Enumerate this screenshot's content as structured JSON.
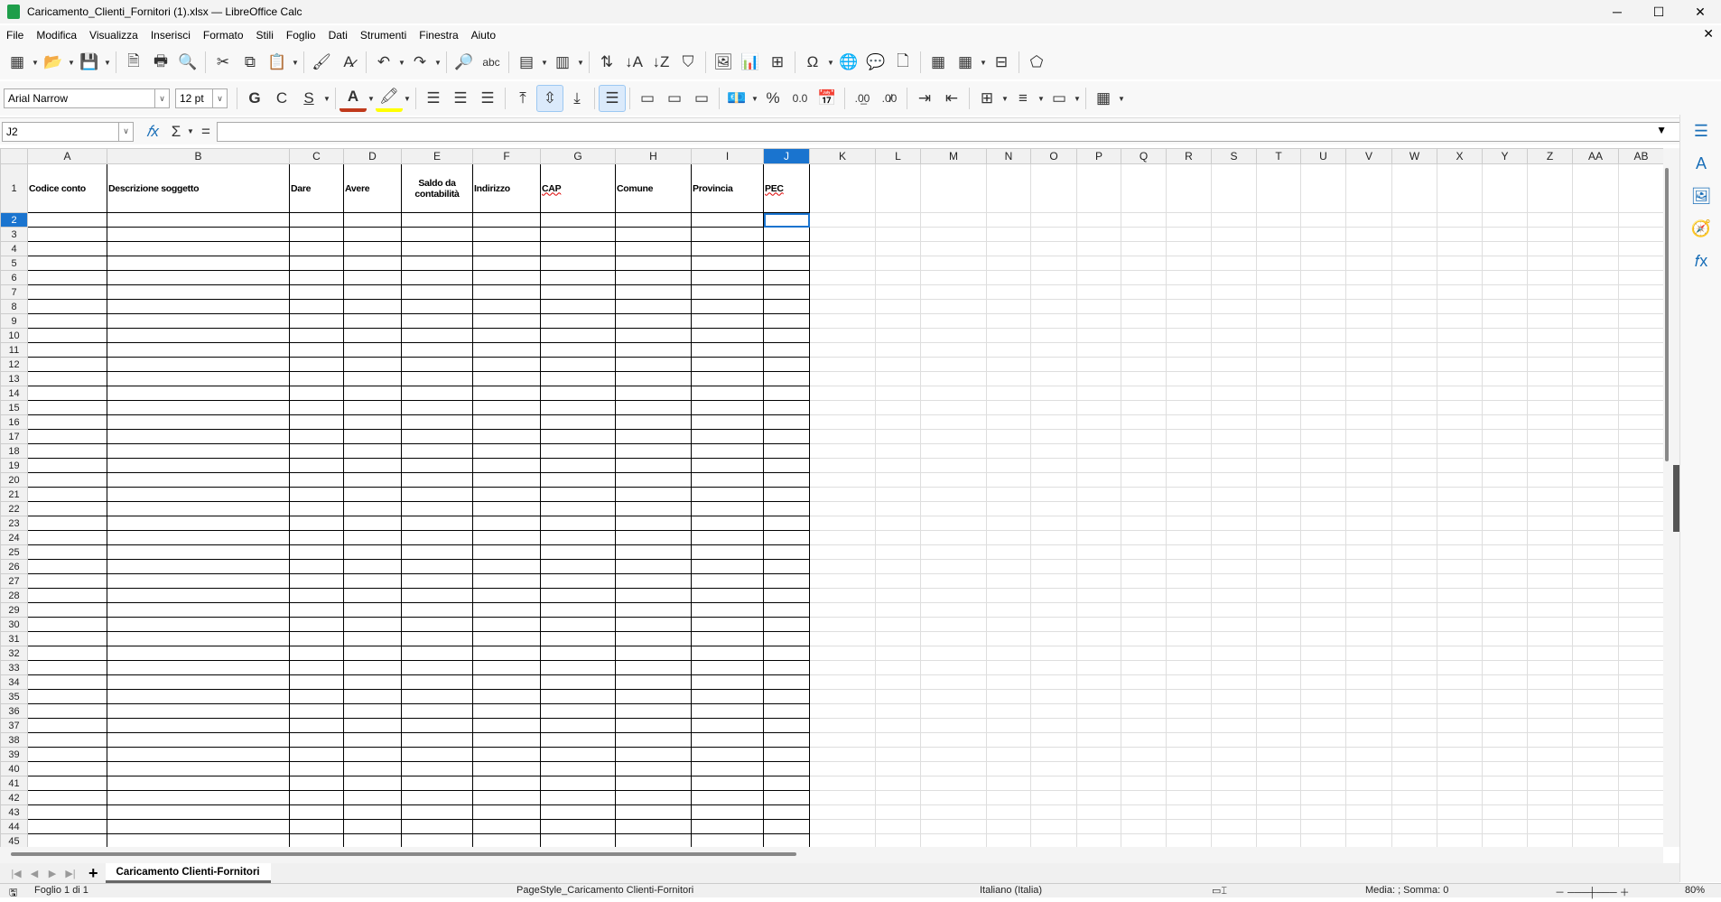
{
  "window": {
    "title": "Caricamento_Clienti_Fornitori (1).xlsx — LibreOffice Calc",
    "minimize": "─",
    "maximize": "☐",
    "close": "✕",
    "close_doc": "✕"
  },
  "menu": [
    "File",
    "Modifica",
    "Visualizza",
    "Inserisci",
    "Formato",
    "Stili",
    "Foglio",
    "Dati",
    "Strumenti",
    "Finestra",
    "Aiuto"
  ],
  "toolbar1": [
    {
      "icon": "new-spreadsheet-icon",
      "glyph": "▦",
      "dd": true
    },
    {
      "icon": "open-folder-icon",
      "glyph": "📂",
      "dd": true
    },
    {
      "icon": "save-icon",
      "glyph": "💾",
      "dd": true
    },
    "sep",
    {
      "icon": "export-pdf-icon",
      "glyph": "🗎"
    },
    {
      "icon": "print-icon",
      "glyph": "🖶"
    },
    {
      "icon": "print-preview-icon",
      "glyph": "🔍"
    },
    "sep",
    {
      "icon": "cut-icon",
      "glyph": "✂"
    },
    {
      "icon": "copy-icon",
      "glyph": "⧉"
    },
    {
      "icon": "paste-icon",
      "glyph": "📋",
      "dd": true
    },
    "sep",
    {
      "icon": "clone-formatting-icon",
      "glyph": "🖌"
    },
    {
      "icon": "clear-formatting-icon",
      "glyph": "A̷"
    },
    "sep",
    {
      "icon": "undo-icon",
      "glyph": "↶",
      "dd": true
    },
    {
      "icon": "redo-icon",
      "glyph": "↷",
      "dd": true
    },
    "sep",
    {
      "icon": "find-replace-icon",
      "glyph": "🔎"
    },
    {
      "icon": "spelling-icon",
      "glyph": "abc"
    },
    "sep",
    {
      "icon": "row-icon",
      "glyph": "▤",
      "dd": true
    },
    {
      "icon": "column-icon",
      "glyph": "▥",
      "dd": true
    },
    "sep",
    {
      "icon": "sort-icon",
      "glyph": "⇅"
    },
    {
      "icon": "sort-ascending-icon",
      "glyph": "↓A"
    },
    {
      "icon": "sort-descending-icon",
      "glyph": "↓Z"
    },
    {
      "icon": "autofilter-icon",
      "glyph": "⛉"
    },
    "sep",
    {
      "icon": "insert-image-icon",
      "glyph": "🖼"
    },
    {
      "icon": "insert-chart-icon",
      "glyph": "📊"
    },
    {
      "icon": "pivot-table-icon",
      "glyph": "⊞"
    },
    "sep",
    {
      "icon": "special-character-icon",
      "glyph": "Ω",
      "dd": true
    },
    {
      "icon": "hyperlink-icon",
      "glyph": "🌐"
    },
    {
      "icon": "comment-icon",
      "glyph": "💬"
    },
    {
      "icon": "header-footer-icon",
      "glyph": "🗋"
    },
    "sep",
    {
      "icon": "define-print-area-icon",
      "glyph": "▦"
    },
    {
      "icon": "freeze-rows-columns-icon",
      "glyph": "▦",
      "dd": true
    },
    {
      "icon": "split-window-icon",
      "glyph": "⊟"
    },
    "sep",
    {
      "icon": "show-draw-functions-icon",
      "glyph": "⬠"
    }
  ],
  "font": {
    "name": "Arial Narrow",
    "size": "12 pt"
  },
  "toolbar2": [
    {
      "icon": "bold-icon",
      "glyph": "G"
    },
    {
      "icon": "italic-icon",
      "glyph": "C"
    },
    {
      "icon": "underline-icon",
      "glyph": "S",
      "dd": true
    },
    "sep",
    {
      "icon": "font-color-icon",
      "glyph": "A",
      "dd": true
    },
    {
      "icon": "highlight-color-icon",
      "glyph": "🖍",
      "dd": true
    },
    "sep",
    {
      "icon": "align-left-icon",
      "glyph": "☰"
    },
    {
      "icon": "align-center-icon",
      "glyph": "☰"
    },
    {
      "icon": "align-right-icon",
      "glyph": "☰"
    },
    "sep",
    {
      "icon": "align-top-icon",
      "glyph": "⤒"
    },
    {
      "icon": "align-center-vertical-icon",
      "glyph": "⇳",
      "active": true
    },
    {
      "icon": "align-bottom-icon",
      "glyph": "⤓"
    },
    "sep",
    {
      "icon": "wrap-text-icon",
      "glyph": "☰",
      "active": true
    },
    "sep",
    {
      "icon": "merge-center-icon",
      "glyph": "▭"
    },
    {
      "icon": "merge-cells-icon",
      "glyph": "▭"
    },
    {
      "icon": "unmerge-cells-icon",
      "glyph": "▭"
    },
    "sep",
    {
      "icon": "currency-format-icon",
      "glyph": "💶",
      "dd": true
    },
    {
      "icon": "percent-format-icon",
      "glyph": "%"
    },
    {
      "icon": "number-format-icon",
      "glyph": "0.0"
    },
    {
      "icon": "date-format-icon",
      "glyph": "📅"
    },
    "sep",
    {
      "icon": "add-decimal-icon",
      "glyph": ".0̲0"
    },
    {
      "icon": "delete-decimal-icon",
      "glyph": ".0̸0"
    },
    "sep",
    {
      "icon": "increase-indent-icon",
      "glyph": "⇥"
    },
    {
      "icon": "decrease-indent-icon",
      "glyph": "⇤"
    },
    "sep",
    {
      "icon": "borders-icon",
      "glyph": "⊞",
      "dd": true
    },
    {
      "icon": "border-style-icon",
      "glyph": "≡",
      "dd": true
    },
    {
      "icon": "border-color-icon",
      "glyph": "▭",
      "dd": true
    },
    "sep",
    {
      "icon": "conditional-format-icon",
      "glyph": "▦",
      "dd": true
    }
  ],
  "formula_bar": {
    "name_box": "J2",
    "function_wizard": "𝑓x",
    "sum": "Σ",
    "equals": "=",
    "formula": ""
  },
  "columns": [
    "A",
    "B",
    "C",
    "D",
    "E",
    "F",
    "G",
    "H",
    "I",
    "J",
    "K",
    "L",
    "M",
    "N",
    "O",
    "P",
    "Q",
    "R",
    "S",
    "T",
    "U",
    "V",
    "W",
    "X",
    "Y",
    "Z",
    "AA",
    "AB"
  ],
  "header_row": [
    "Codice conto",
    "Descrizione soggetto",
    "Dare",
    "Avere",
    "Saldo da contabilità",
    "Indirizzo",
    "CAP",
    "Comune",
    "Provincia",
    "PEC"
  ],
  "row_count": 45,
  "selected_cell": "J2",
  "colors": {
    "selection": "#1a74cf",
    "font_color": "#c0391b",
    "highlight_color": "#ffff00"
  },
  "sheet_tabs": {
    "add": "+",
    "active": "Caricamento Clienti-Fornitori"
  },
  "status": {
    "sheet": "Foglio 1 di 1",
    "page_style": "PageStyle_Caricamento Clienti-Fornitori",
    "language": "Italiano (Italia)",
    "sum": "Media: ; Somma: 0",
    "zoom": "80%"
  },
  "sidebar": [
    {
      "icon": "properties-icon",
      "glyph": "☰"
    },
    {
      "icon": "styles-icon",
      "glyph": "A"
    },
    {
      "icon": "gallery-icon",
      "glyph": "🖼"
    },
    {
      "icon": "navigator-icon",
      "glyph": "🧭"
    },
    {
      "icon": "functions-icon",
      "glyph": "𝑓x"
    }
  ]
}
